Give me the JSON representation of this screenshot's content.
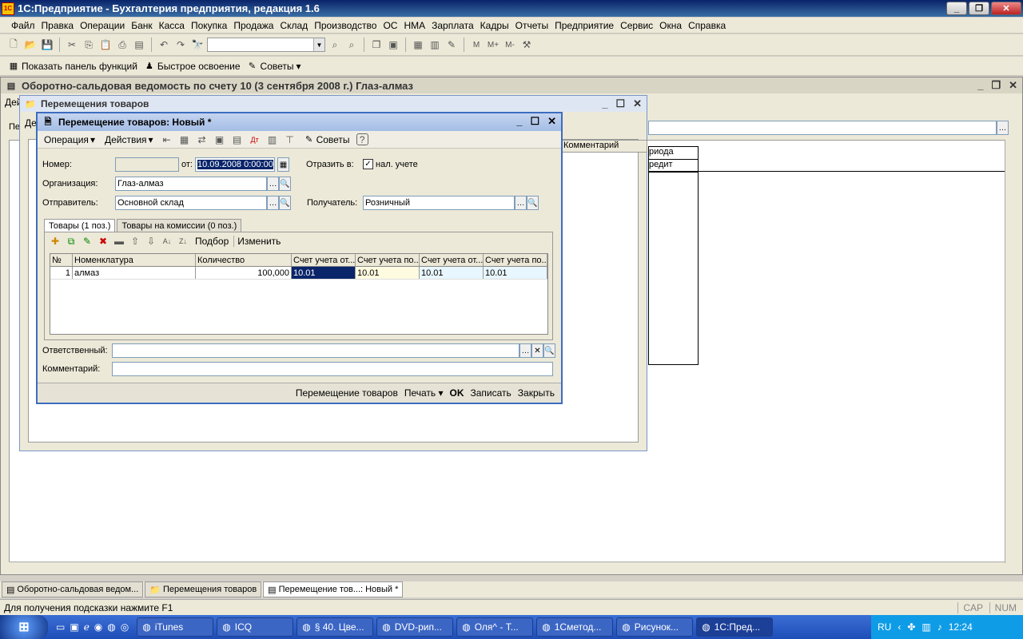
{
  "app": {
    "title": "1С:Предприятие - Бухгалтерия предприятия, редакция 1.6"
  },
  "menu": [
    "Файл",
    "Правка",
    "Операции",
    "Банк",
    "Касса",
    "Покупка",
    "Продажа",
    "Склад",
    "Производство",
    "ОС",
    "НМА",
    "Зарплата",
    "Кадры",
    "Отчеты",
    "Предприятие",
    "Сервис",
    "Окна",
    "Справка"
  ],
  "toolbar2": {
    "show_panel": "Показать панель функций",
    "quick": "Быстрое освоение",
    "tips": "Советы"
  },
  "bg_window": {
    "title": "Оборотно-сальдовая ведомость по счету 10 (3 сентября 2008 г.) Глаз-алмаз",
    "partial1": "Дей",
    "partial2": "Пе",
    "col_period": "риода",
    "col_credit": "редит"
  },
  "list_window": {
    "title": "Перемещения товаров",
    "partial": "Де",
    "comment_col": "Комментарий"
  },
  "doc": {
    "title": "Перемещение товаров: Новый *",
    "toolbar": {
      "operation": "Операция",
      "actions": "Действия",
      "tips": "Советы"
    },
    "number_label": "Номер:",
    "number_value": "",
    "from_label": "от:",
    "date_value": "10.09.2008  0:00:00",
    "reflect_label": "Отразить в:",
    "tax_label": "нал. учете",
    "org_label": "Организация:",
    "org_value": "Глаз-алмаз",
    "sender_label": "Отправитель:",
    "sender_value": "Основной склад",
    "receiver_label": "Получатель:",
    "receiver_value": "Розничный",
    "tabs": [
      "Товары (1 поз.)",
      "Товары на комиссии (0 поз.)"
    ],
    "grid_toolbar": {
      "pick": "Подбор",
      "change": "Изменить"
    },
    "columns": [
      "№",
      "Номенклатура",
      "Количество",
      "Счет учета от...",
      "Счет учета по...",
      "Счет учета от...",
      "Счет учета по..."
    ],
    "rows": [
      [
        "1",
        "алмаз",
        "100,000",
        "10.01",
        "10.01",
        "10.01",
        "10.01"
      ]
    ],
    "resp_label": "Ответственный:",
    "resp_value": "",
    "comment_label": "Комментарий:",
    "comment_value": "",
    "footer": {
      "move": "Перемещение товаров",
      "print": "Печать",
      "ok": "OK",
      "save": "Записать",
      "close": "Закрыть"
    }
  },
  "window_tabs": [
    "Оборотно-сальдовая ведом...",
    "Перемещения товаров",
    "Перемещение тов...: Новый *"
  ],
  "status": {
    "hint": "Для получения подсказки нажмите F1",
    "cap": "CAP",
    "num": "NUM"
  },
  "taskbar": {
    "items": [
      "iTunes",
      "ICQ",
      "§ 40. Цве...",
      "DVD-рип...",
      "Оля^ - Т...",
      "1Сметод...",
      "Рисунок...",
      "1С:Пред..."
    ],
    "lang": "RU",
    "time": "12:24"
  }
}
